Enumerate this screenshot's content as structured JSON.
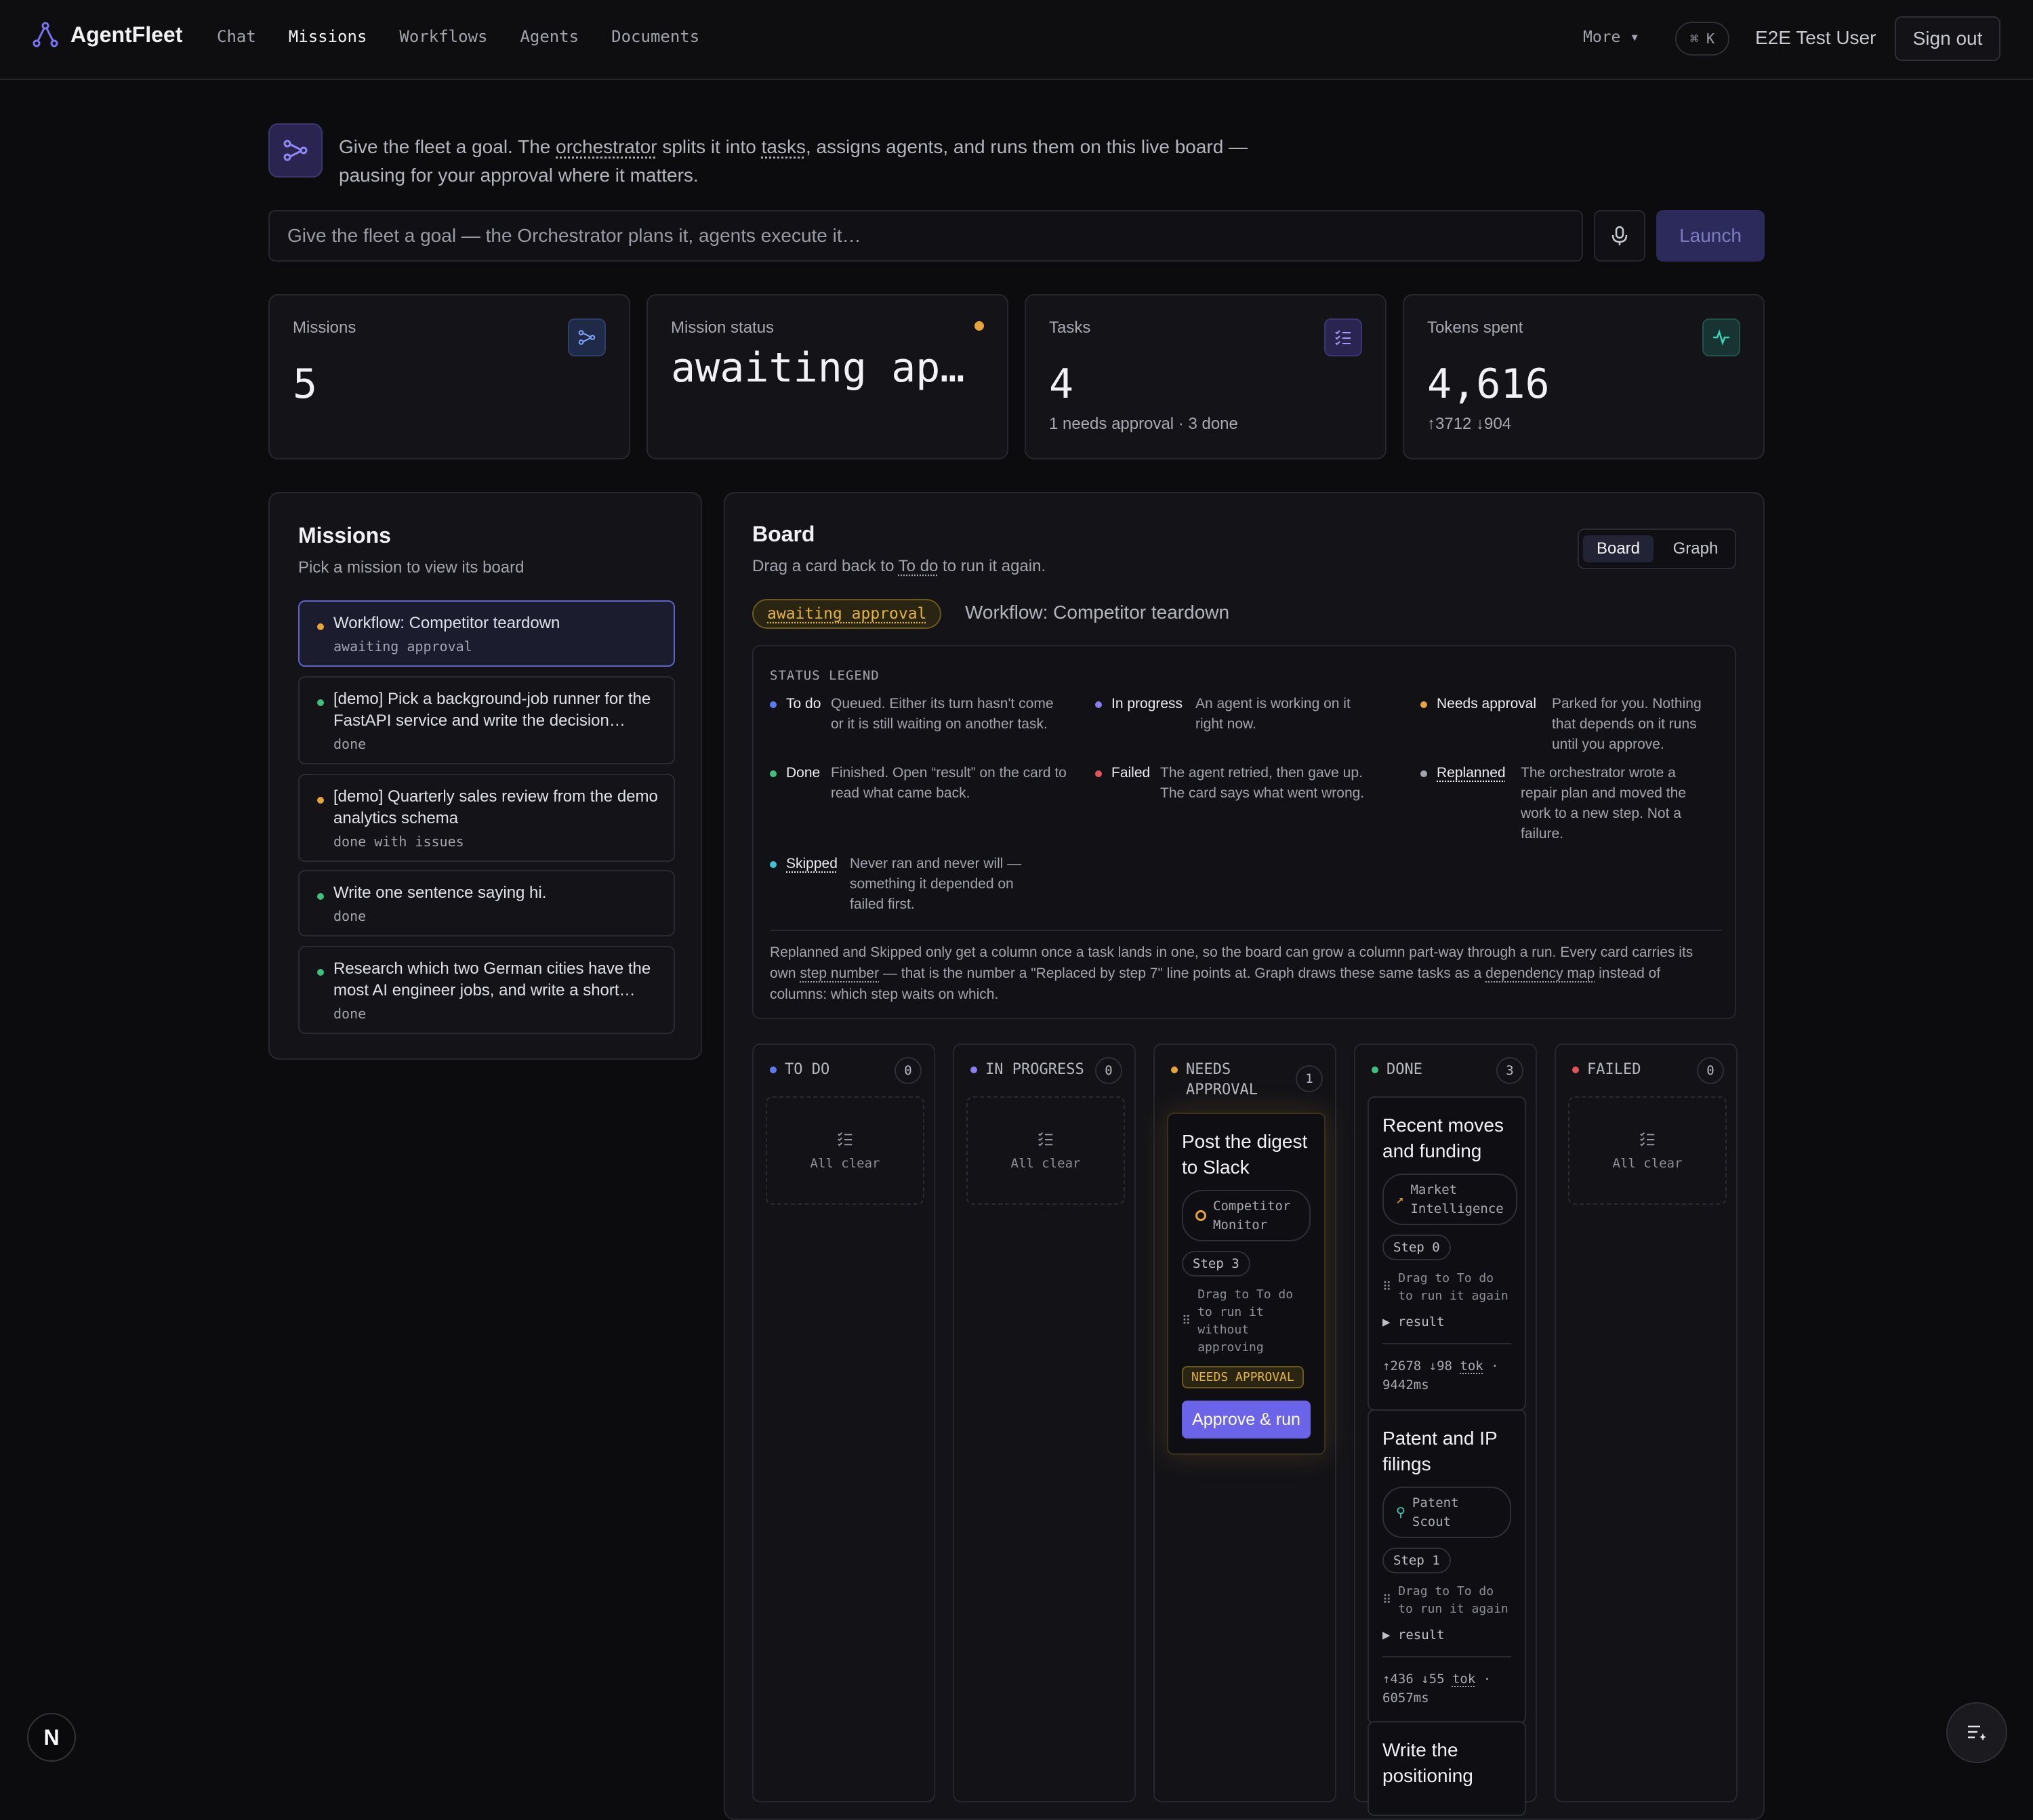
{
  "header": {
    "app_name": "AgentFleet",
    "nav": [
      "Chat",
      "Missions",
      "Workflows",
      "Agents",
      "Documents"
    ],
    "active_nav": "Missions",
    "more": "More ▾",
    "shortcut": "⌘ K",
    "user": "E2E Test User",
    "signout": "Sign out"
  },
  "intro": {
    "pre": "Give the fleet a goal. The ",
    "term1": "orchestrator",
    "mid": " splits it into ",
    "term2": "tasks",
    "post": ", assigns agents, and runs them on this live board — pausing for your approval where it matters."
  },
  "goal": {
    "placeholder": "Give the fleet a goal — the Orchestrator plans it, agents execute it…",
    "launch": "Launch"
  },
  "stats": {
    "missions": {
      "label": "Missions",
      "value": "5"
    },
    "status": {
      "label": "Mission status",
      "value": "awaiting ap…"
    },
    "tasks": {
      "label": "Tasks",
      "value": "4",
      "sub": "1 needs approval · 3 done"
    },
    "tokens": {
      "label": "Tokens spent",
      "value": "4,616",
      "sub": "↑3712 ↓904"
    }
  },
  "missions_panel": {
    "title": "Missions",
    "subtitle": "Pick a mission to view its board",
    "items": [
      {
        "title": "Workflow: Competitor teardown",
        "status": "awaiting approval",
        "color": "#e5a33c"
      },
      {
        "title": "[demo] Pick a background-job runner for the FastAPI service and write the decision…",
        "status": "done",
        "color": "#3fbf7f"
      },
      {
        "title": "[demo] Quarterly sales review from the demo analytics schema",
        "status": "done with issues",
        "color": "#e5a33c"
      },
      {
        "title": "Write one sentence saying hi.",
        "status": "done",
        "color": "#3fbf7f"
      },
      {
        "title": "Research which two German cities have the most AI engineer jobs, and write a short…",
        "status": "done",
        "color": "#3fbf7f"
      }
    ]
  },
  "board": {
    "title": "Board",
    "sub_pre": "Drag a card back to ",
    "sub_term": "To do",
    "sub_post": " to run it again.",
    "view_board": "Board",
    "view_graph": "Graph",
    "status_pill": "awaiting approval",
    "mission_name": "Workflow: Competitor teardown",
    "legend_title": "STATUS LEGEND",
    "legend": {
      "todo": {
        "name": "To do",
        "desc": "Queued. Either its turn hasn't come or it is still waiting on another task.",
        "color": "#5b7cf0"
      },
      "inprogress": {
        "name": "In progress",
        "desc": "An agent is working on it right now.",
        "color": "#8b7cf0"
      },
      "approval": {
        "name": "Needs approval",
        "desc": "Parked for you. Nothing that depends on it runs until you approve.",
        "color": "#e5a33c"
      },
      "done": {
        "name": "Done",
        "desc": "Finished. Open “result” on the card to read what came back.",
        "color": "#3fbf7f"
      },
      "failed": {
        "name": "Failed",
        "desc": "The agent retried, then gave up. The card says what went wrong.",
        "color": "#e0555a"
      },
      "replanned": {
        "name": "Replanned",
        "desc": "The orchestrator wrote a repair plan and moved the work to a new step. Not a failure.",
        "color": "#a3a3ad"
      },
      "skipped": {
        "name": "Skipped",
        "desc": "Never ran and never will — something it depended on failed first.",
        "color": "#3cc2d8"
      }
    },
    "note": {
      "a": "Replanned and Skipped only get a column once a task lands in one, so the board can grow a column part-way through a run. Every card carries its own ",
      "t1": "step number",
      "b": " — that is the number a \"Replaced by step 7\" line points at. Graph draws these same tasks as a ",
      "t2": "dependency map",
      "c": " instead of columns: which step waits on which."
    },
    "columns": [
      {
        "name": "TO DO",
        "count": "0",
        "color": "#5b7cf0",
        "empty": "All clear"
      },
      {
        "name": "IN PROGRESS",
        "count": "0",
        "color": "#8b7cf0",
        "empty": "All clear"
      },
      {
        "name": "NEEDS APPROVAL",
        "count": "1",
        "color": "#e5a33c"
      },
      {
        "name": "DONE",
        "count": "3",
        "color": "#3fbf7f"
      },
      {
        "name": "FAILED",
        "count": "0",
        "color": "#e0555a",
        "empty": "All clear"
      }
    ],
    "approval_card": {
      "title": "Post the digest to Slack",
      "agent": "Competitor Monitor",
      "step": "Step 3",
      "drag": "Drag to To do to run it without approving",
      "badge": "NEEDS APPROVAL",
      "button": "Approve & run"
    },
    "done_cards": [
      {
        "title": "Recent moves and funding",
        "agent": "Market Intelligence",
        "step": "Step 0",
        "drag": "Drag to To do to run it again",
        "result": "result",
        "tok_pre": "↑2678 ↓98 ",
        "tok_term": "tok",
        "tok_post": " · 9442ms"
      },
      {
        "title": "Patent and IP filings",
        "agent": "Patent Scout",
        "step": "Step 1",
        "drag": "Drag to To do to run it again",
        "result": "result",
        "tok_pre": "↑436 ↓55 ",
        "tok_term": "tok",
        "tok_post": " · 6057ms"
      },
      {
        "title": "Write the positioning"
      }
    ]
  },
  "footer": {
    "n_badge": "N"
  }
}
